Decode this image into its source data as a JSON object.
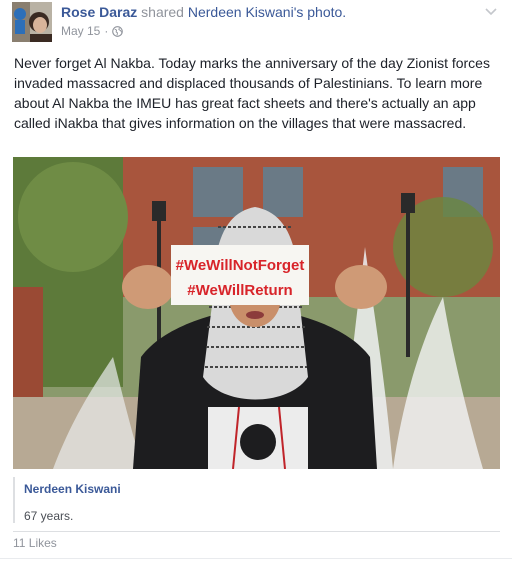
{
  "post": {
    "author": "Rose Daraz",
    "shared_text": "shared",
    "shared_from": "Nerdeen Kiswani's photo.",
    "date": "May 15",
    "separator": "·",
    "body": "Never forget Al Nakba. Today marks the anniversary of the day Zionist forces invaded massacred and displaced thousands of Palestinians. To learn more about Al Nakba the IMEU has great fact sheets and there's actually an app called iNakba that gives information on the villages that were massacred.",
    "photo": {
      "sign_line_1": "#WeWillNotForget",
      "sign_line_2": "#WeWillReturn"
    },
    "original": {
      "name": "Nerdeen Kiswani",
      "caption": "67 years."
    },
    "likes": "11 Likes"
  },
  "icons": {
    "audience": "globe-icon",
    "menu": "chevron-down-icon"
  },
  "colors": {
    "link": "#3b5998",
    "muted": "#90949c",
    "sign_red": "#d8242a"
  }
}
